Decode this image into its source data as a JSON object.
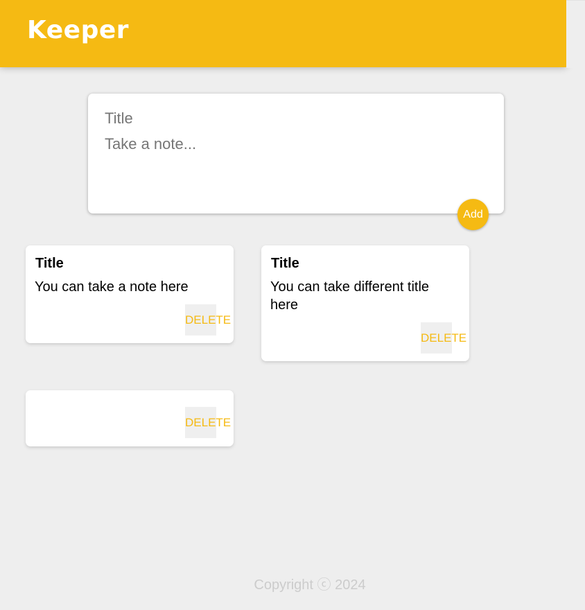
{
  "header": {
    "title": "Keeper"
  },
  "create_area": {
    "title_placeholder": "Title",
    "content_placeholder": "Take a note...",
    "add_label": "Add"
  },
  "notes": [
    {
      "title": "Title",
      "content": "You can take a note here",
      "delete_label": "DELETE"
    },
    {
      "title": "Title",
      "content": "You can take different title here",
      "delete_label": "DELETE"
    },
    {
      "title": "",
      "content": "",
      "delete_label": "DELETE"
    }
  ],
  "footer": {
    "text": "Copyright ⓒ 2024"
  },
  "colors": {
    "accent": "#f5ba13",
    "background": "#eeeeee",
    "note_background": "#ffffff",
    "footer_text": "#cccccc"
  }
}
